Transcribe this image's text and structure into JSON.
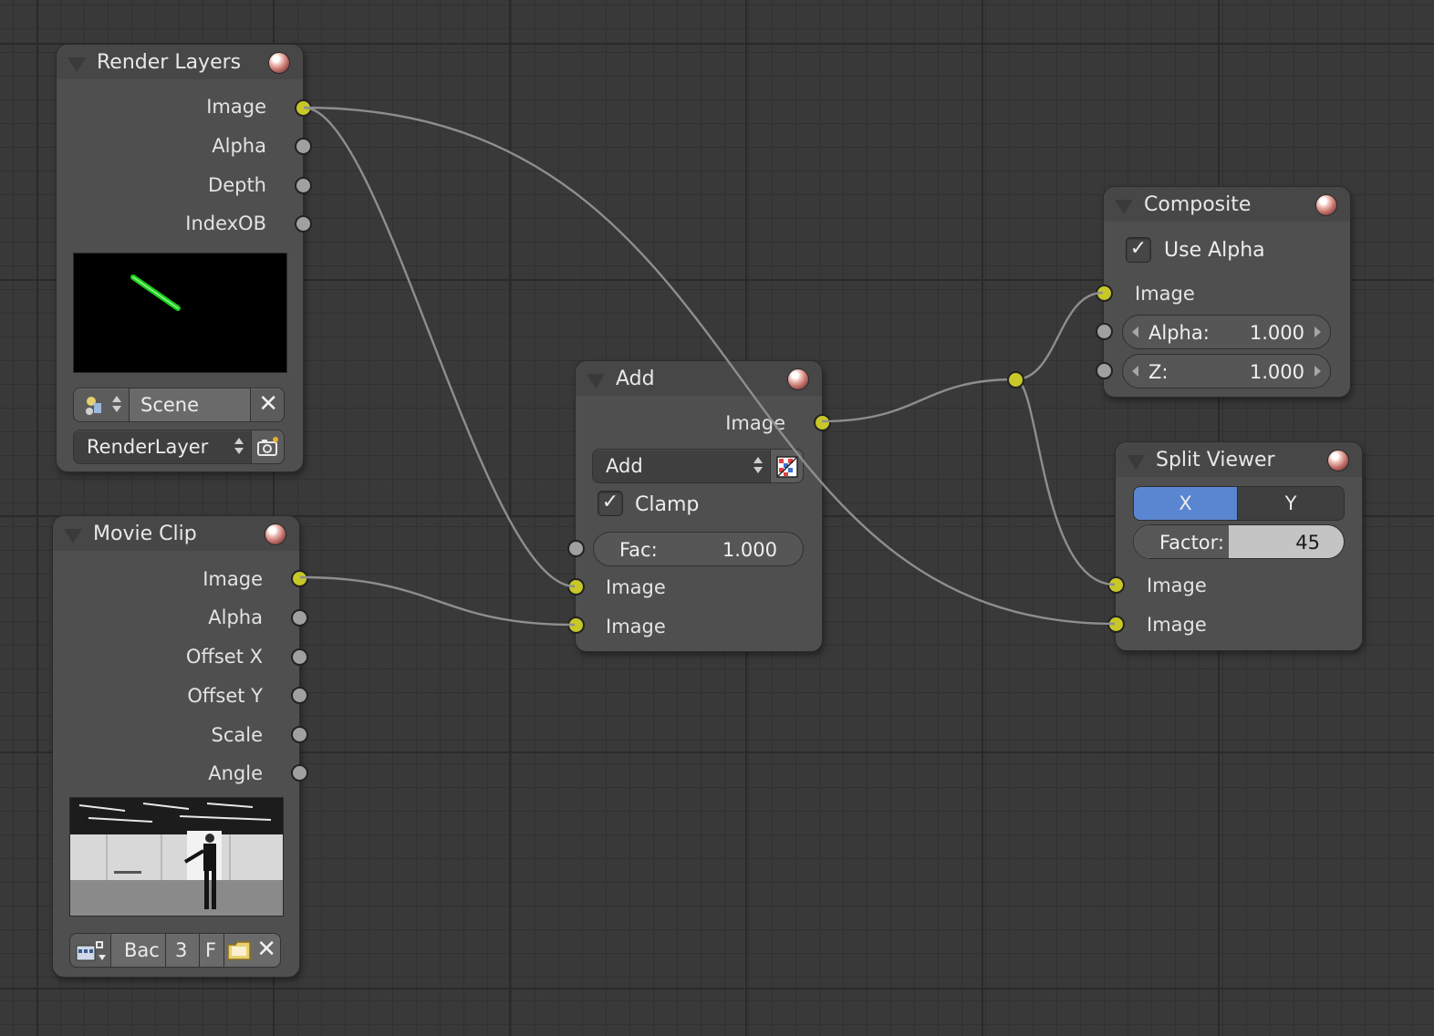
{
  "nodes": {
    "render_layers": {
      "title": "Render Layers",
      "outputs": [
        "Image",
        "Alpha",
        "Depth",
        "IndexOB"
      ],
      "scene_field": "Scene",
      "layer_field": "RenderLayer"
    },
    "movie_clip": {
      "title": "Movie Clip",
      "outputs": [
        "Image",
        "Alpha",
        "Offset X",
        "Offset Y",
        "Scale",
        "Angle"
      ],
      "clip_name": "Bac",
      "user_count": "3",
      "fake_user": "F"
    },
    "add": {
      "title": "Add",
      "output": "Image",
      "blend_mode": "Add",
      "clamp_label": "Clamp",
      "clamp_checked": true,
      "fac_label": "Fac:",
      "fac_value": "1.000",
      "inputs": [
        "Image",
        "Image"
      ]
    },
    "composite": {
      "title": "Composite",
      "use_alpha_label": "Use Alpha",
      "use_alpha_checked": true,
      "input_image": "Image",
      "alpha_label": "Alpha:",
      "alpha_value": "1.000",
      "z_label": "Z:",
      "z_value": "1.000"
    },
    "split_viewer": {
      "title": "Split Viewer",
      "axis_x": "X",
      "axis_y": "Y",
      "axis_selected": "X",
      "factor_label": "Factor:",
      "factor_value": "45",
      "factor_fraction": 0.45,
      "inputs": [
        "Image",
        "Image"
      ]
    }
  },
  "colors": {
    "socket_image": "#c8c828",
    "socket_value": "#a0a0a0",
    "selected_accent": "#5a85d0",
    "preview_line": "#19d019"
  }
}
